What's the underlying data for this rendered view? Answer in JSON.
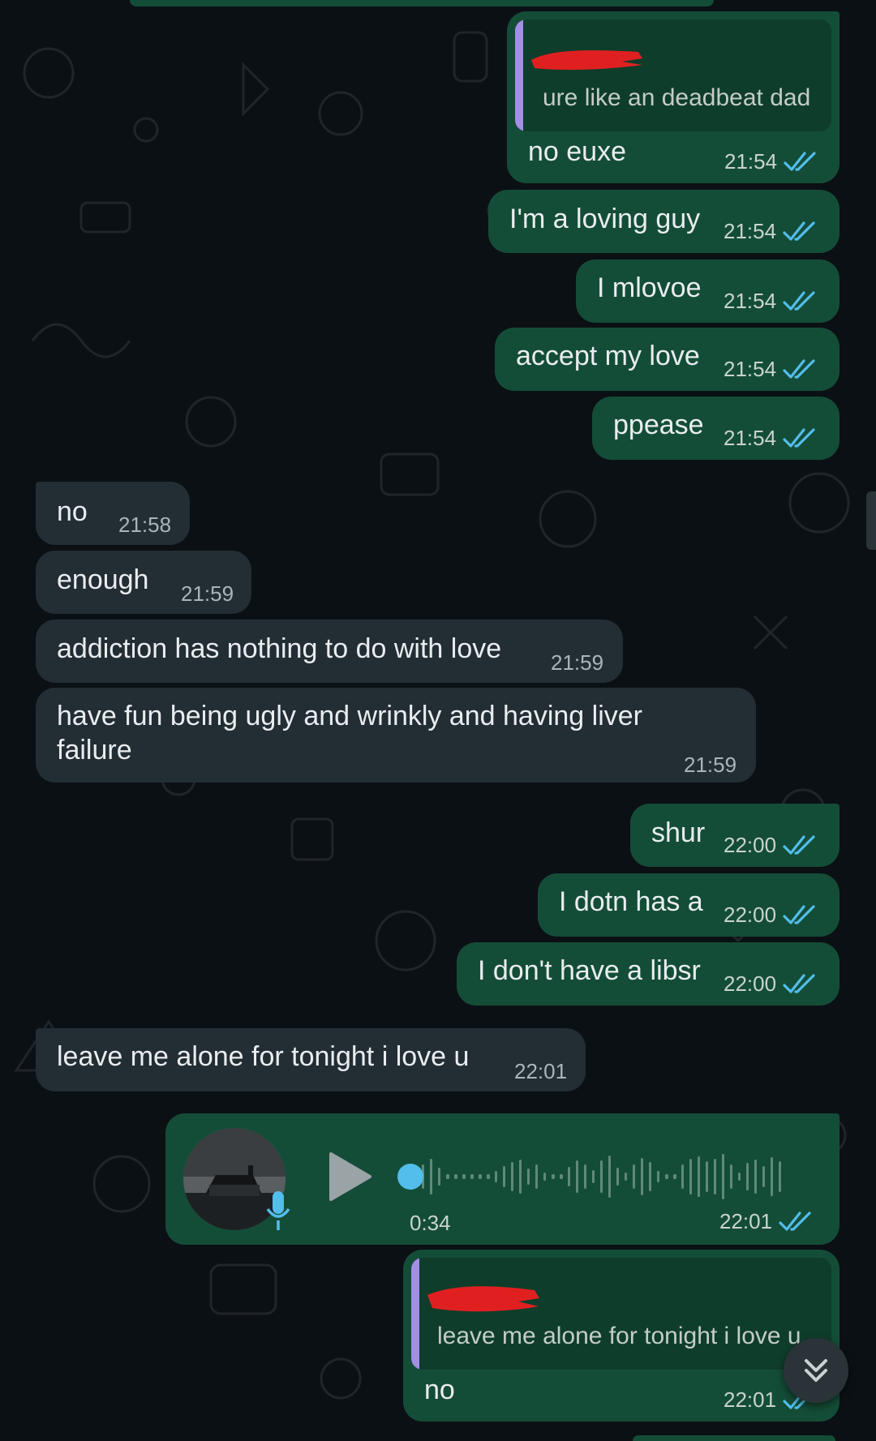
{
  "colors": {
    "outgoing_bubble": "#144d37",
    "incoming_bubble": "#232d34",
    "read_ticks": "#53bdeb",
    "chat_background": "#0b1014"
  },
  "messages": [
    {
      "direction": "out",
      "quote": {
        "sender": "[redacted]",
        "text": "ure like an deadbeat dad"
      },
      "text": "no euxe",
      "time": "21:54",
      "status": "read"
    },
    {
      "direction": "out",
      "text": "I'm a loving guy",
      "time": "21:54",
      "status": "read"
    },
    {
      "direction": "out",
      "text": "I mlovoe",
      "time": "21:54",
      "status": "read"
    },
    {
      "direction": "out",
      "text": "accept my love",
      "time": "21:54",
      "status": "read"
    },
    {
      "direction": "out",
      "text": "ppease",
      "time": "21:54",
      "status": "read"
    },
    {
      "direction": "in",
      "text": "no",
      "time": "21:58"
    },
    {
      "direction": "in",
      "text": "enough",
      "time": "21:59"
    },
    {
      "direction": "in",
      "text": "addiction has nothing to do with love",
      "time": "21:59"
    },
    {
      "direction": "in",
      "text": "have fun being ugly and wrinkly and having liver failure",
      "time": "21:59"
    },
    {
      "direction": "out",
      "text": "shur",
      "time": "22:00",
      "status": "read"
    },
    {
      "direction": "out",
      "text": "I dotn has a",
      "time": "22:00",
      "status": "read"
    },
    {
      "direction": "out",
      "text": "I don't have a libsr",
      "time": "22:00",
      "status": "read"
    },
    {
      "direction": "in",
      "text": "leave me alone for tonight i love u",
      "time": "22:01"
    },
    {
      "direction": "out",
      "type": "voice",
      "duration": "0:34",
      "time": "22:01",
      "status": "read",
      "progress": 0
    },
    {
      "direction": "out",
      "quote": {
        "sender": "[redacted]",
        "text": "leave me alone for tonight i love u"
      },
      "text": "no",
      "time": "22:01",
      "status": "read"
    }
  ],
  "icons": {
    "read": "double-check-icon",
    "play": "play-icon",
    "mic": "mic-icon",
    "scroll": "double-chevron-down-icon"
  }
}
